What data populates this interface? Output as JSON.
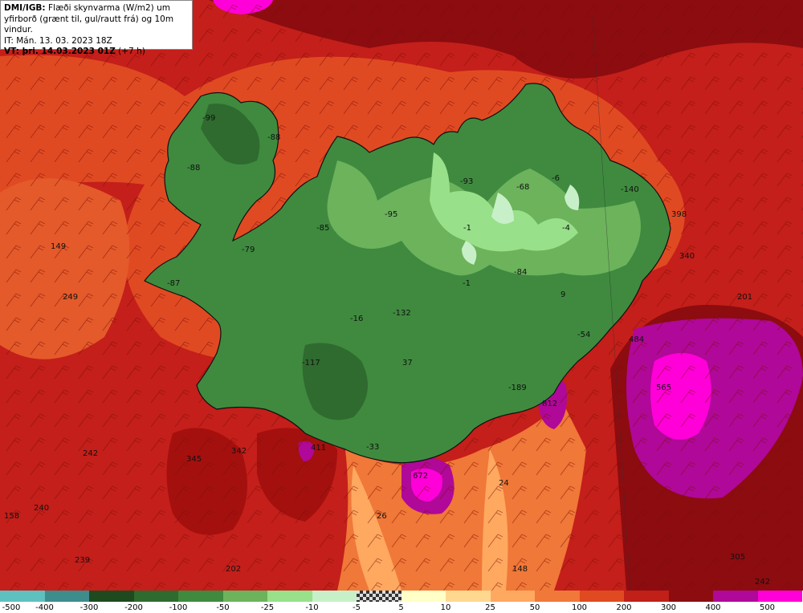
{
  "header": {
    "source": "DMI/IGB:",
    "title_line1": "Flæði skynvarma (W/m2) um",
    "title_line2": "yfirborð (grænt til, gul/rautt frá) og 10m vindur.",
    "it_line": "IT: Mán. 13. 03. 2023 18Z",
    "vt_bold": "VT: þri. 14.03.2023 01Z",
    "vt_suffix": "(+7 h)"
  },
  "legend": {
    "bins": [
      {
        "color": "#5fc0c0"
      },
      {
        "color": "#3e8c8c"
      },
      {
        "color": "#1f4a1f"
      },
      {
        "color": "#2f6a2f"
      },
      {
        "color": "#3f8a3f"
      },
      {
        "color": "#6cb35c"
      },
      {
        "color": "#98e08a"
      },
      {
        "color": "#c8f0c8"
      },
      {
        "color": "checker"
      },
      {
        "color": "#ffffc8"
      },
      {
        "color": "#ffd890"
      },
      {
        "color": "#ffa860"
      },
      {
        "color": "#f07838"
      },
      {
        "color": "#e04a20"
      },
      {
        "color": "#c02018"
      },
      {
        "color": "#8c0c10"
      },
      {
        "color": "#b00898"
      },
      {
        "color": "#ff00d8"
      }
    ],
    "labels": [
      "-500",
      "-400",
      "-300",
      "-200",
      "-100",
      "-50",
      "-25",
      "-10",
      "-5",
      "5",
      "10",
      "25",
      "50",
      "100",
      "200",
      "300",
      "400",
      "500"
    ]
  },
  "map": {
    "values": [
      {
        "text": "-99"
      },
      {
        "text": "-88"
      },
      {
        "text": "-88"
      },
      {
        "text": "-93"
      },
      {
        "text": "-68"
      },
      {
        "text": "-6"
      },
      {
        "text": "-140"
      },
      {
        "text": "-95"
      },
      {
        "text": "-85"
      },
      {
        "text": "-1"
      },
      {
        "text": "-4"
      },
      {
        "text": "-79"
      },
      {
        "text": "-87"
      },
      {
        "text": "-84"
      },
      {
        "text": "-1"
      },
      {
        "text": "9"
      },
      {
        "text": "-16"
      },
      {
        "text": "-132"
      },
      {
        "text": "-54"
      },
      {
        "text": "-117"
      },
      {
        "text": "37"
      },
      {
        "text": "-189"
      },
      {
        "text": "-33"
      },
      {
        "text": "149"
      },
      {
        "text": "249"
      },
      {
        "text": "242"
      },
      {
        "text": "345"
      },
      {
        "text": "342"
      },
      {
        "text": "411"
      },
      {
        "text": "672"
      },
      {
        "text": "24"
      },
      {
        "text": "26"
      },
      {
        "text": "812"
      },
      {
        "text": "565"
      },
      {
        "text": "201"
      },
      {
        "text": "398"
      },
      {
        "text": "340"
      },
      {
        "text": "484"
      },
      {
        "text": "158"
      },
      {
        "text": "240"
      },
      {
        "text": "239"
      },
      {
        "text": "202"
      },
      {
        "text": "148"
      },
      {
        "text": "305"
      },
      {
        "text": "242"
      }
    ]
  }
}
